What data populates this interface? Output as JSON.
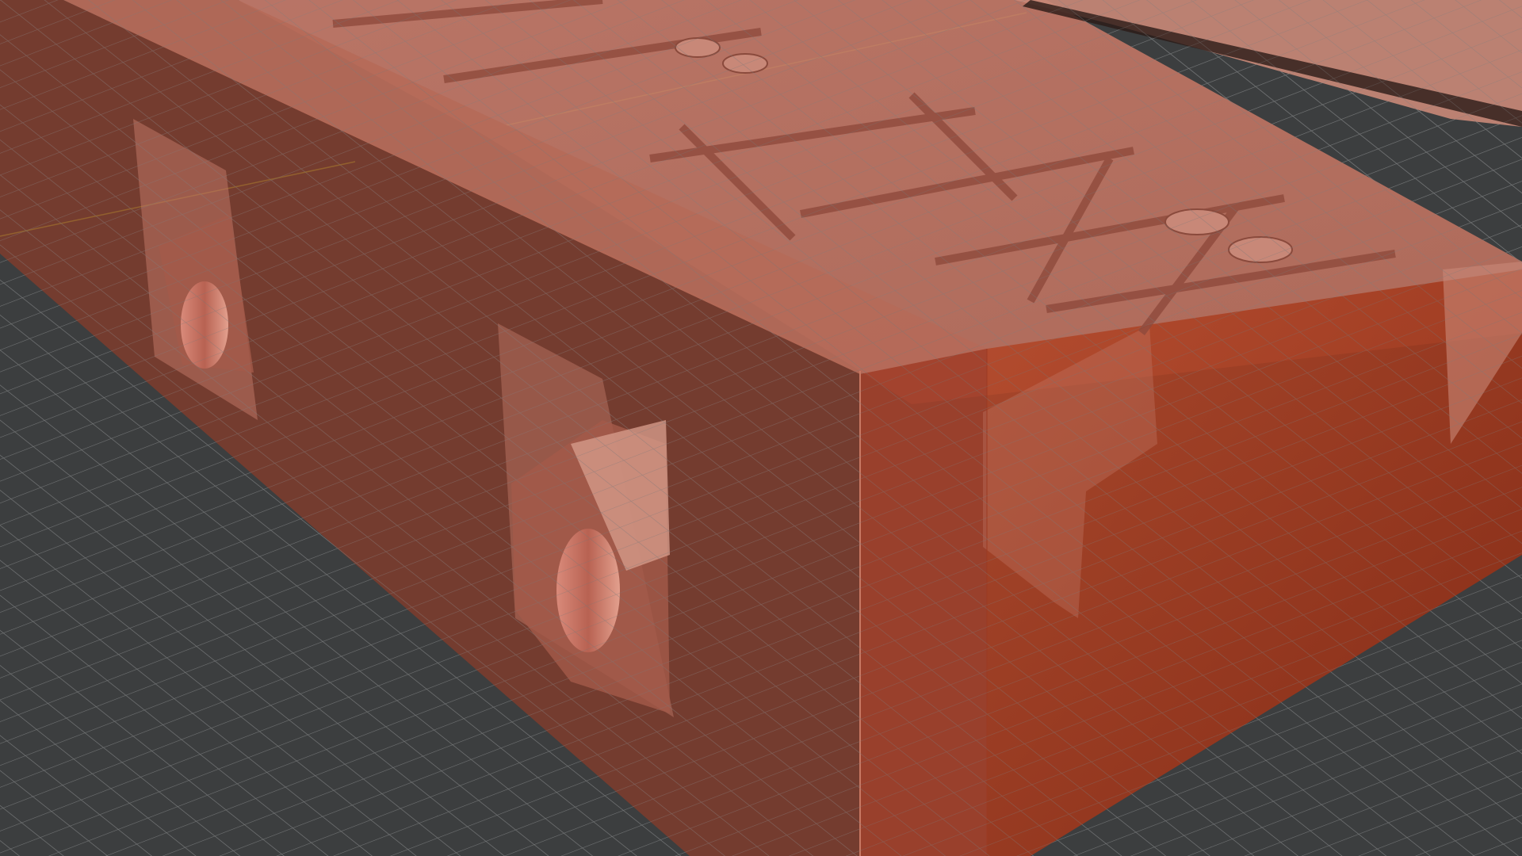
{
  "viewport": {
    "kind": "3d-viewport",
    "background_color": "#3c3e3f",
    "grid": {
      "visible": true,
      "line_color": "#6e7071",
      "axis_color": "#a6bf3c"
    },
    "model": {
      "material_color": "#b86b5a",
      "material_color_dark": "#7c2c1a",
      "display_mode": "x-ray"
    }
  }
}
